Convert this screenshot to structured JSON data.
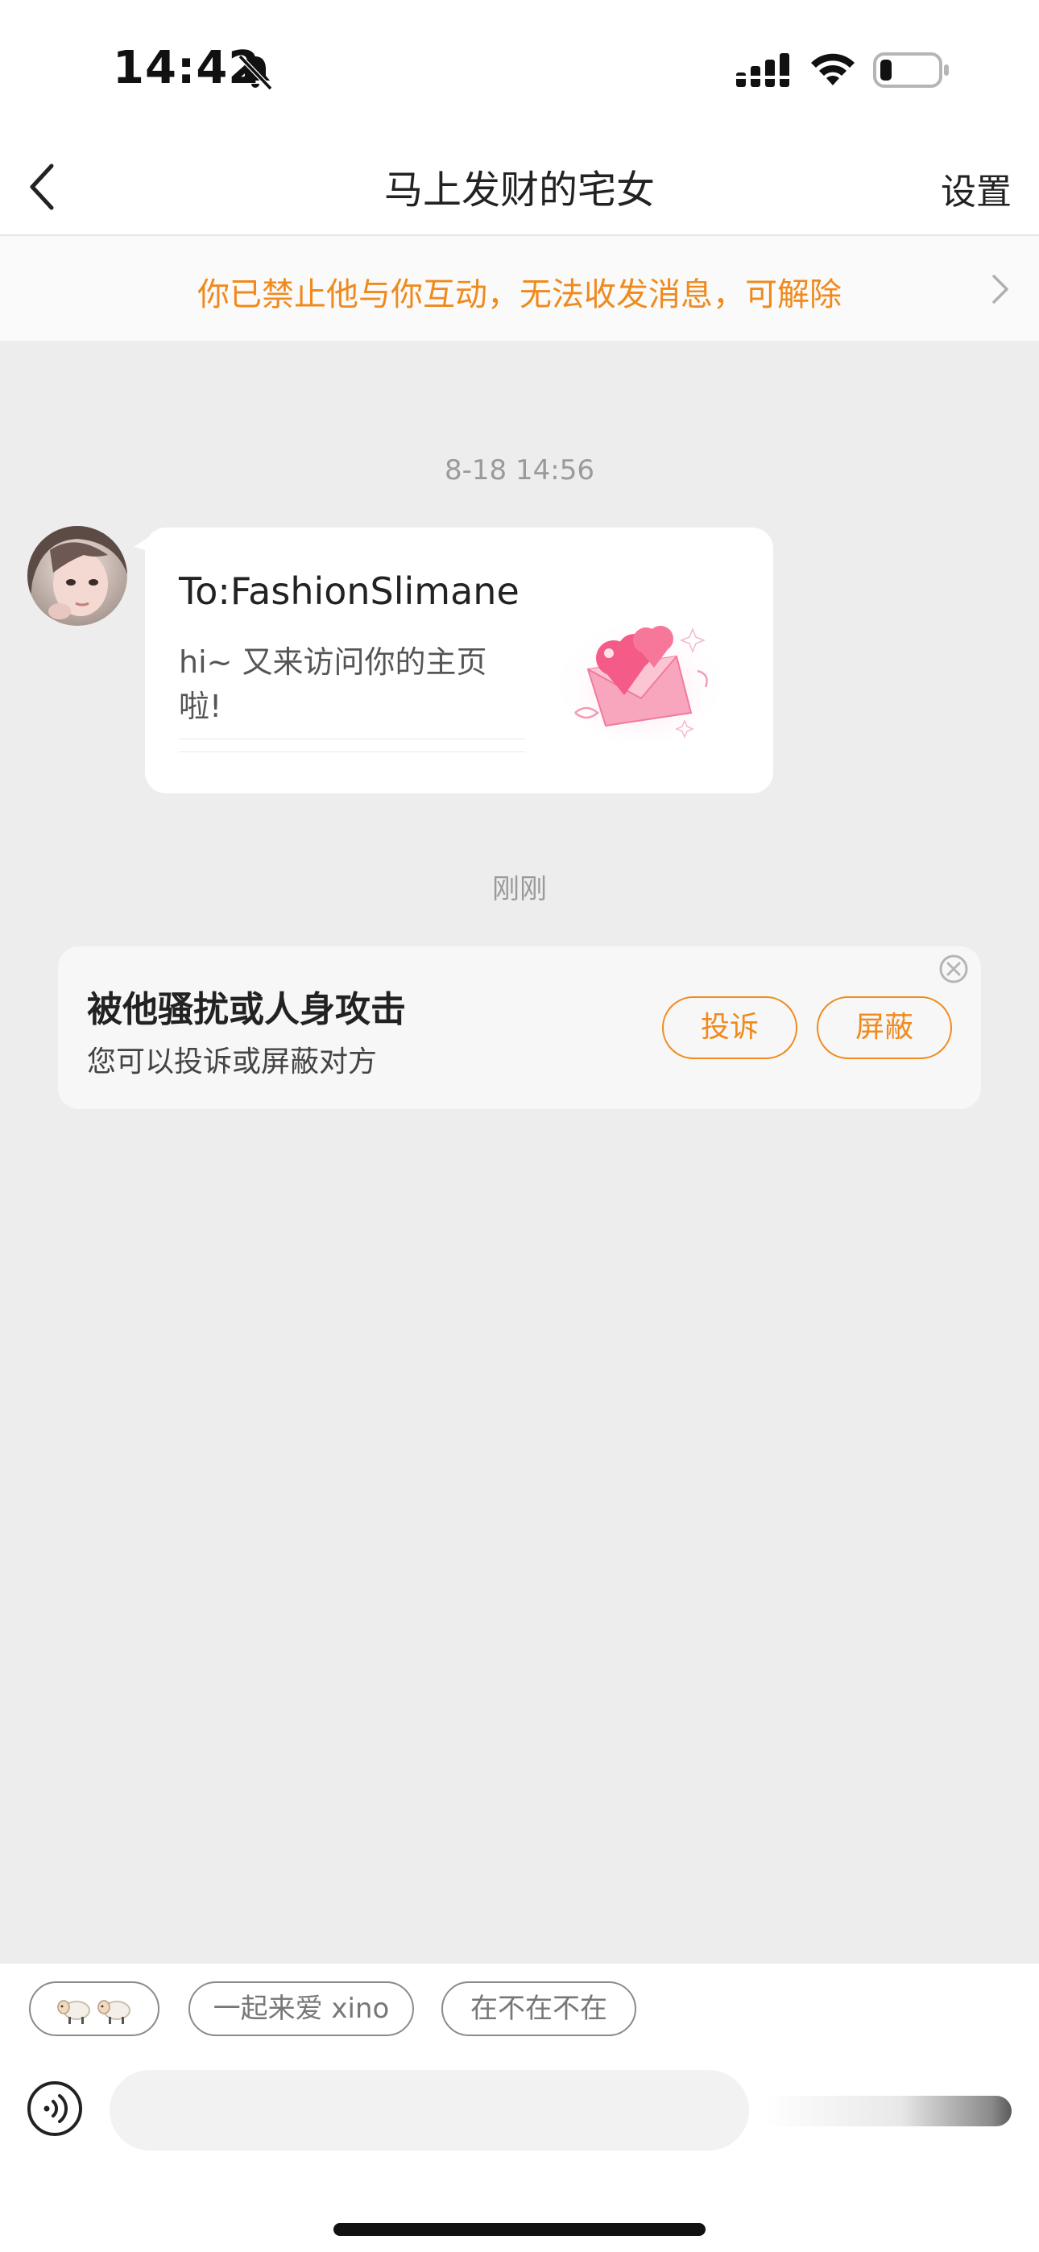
{
  "status_bar": {
    "time": "14:42",
    "icons": [
      "bell-off-icon",
      "signal-icon",
      "wifi-icon",
      "battery-icon"
    ]
  },
  "nav": {
    "title": "马上发财的宅女",
    "settings_label": "设置",
    "back_icon": "chevron-left-icon"
  },
  "banner": {
    "text": "你已禁止他与你互动，无法收发消息，可解除",
    "color": "#f08a1c"
  },
  "messages": [
    {
      "timestamp": "8-18 14:56",
      "card_to": "To:FashionSlimane",
      "card_text": "hi~ 又来访问你的主页啦!",
      "art": "heart-envelope"
    }
  ],
  "recent_timestamp": "刚刚",
  "safety": {
    "title": "被他骚扰或人身攻击",
    "subtitle": "您可以投诉或屏蔽对方",
    "report_label": "投诉",
    "block_label": "屏蔽"
  },
  "quick_replies": {
    "chip1_emoji": "sheep-emoji",
    "chip2": "一起来爱 xino",
    "chip3": "在不在不在"
  },
  "composer": {
    "placeholder": ""
  },
  "colors": {
    "accent": "#f08a1c",
    "background": "#ededed"
  }
}
